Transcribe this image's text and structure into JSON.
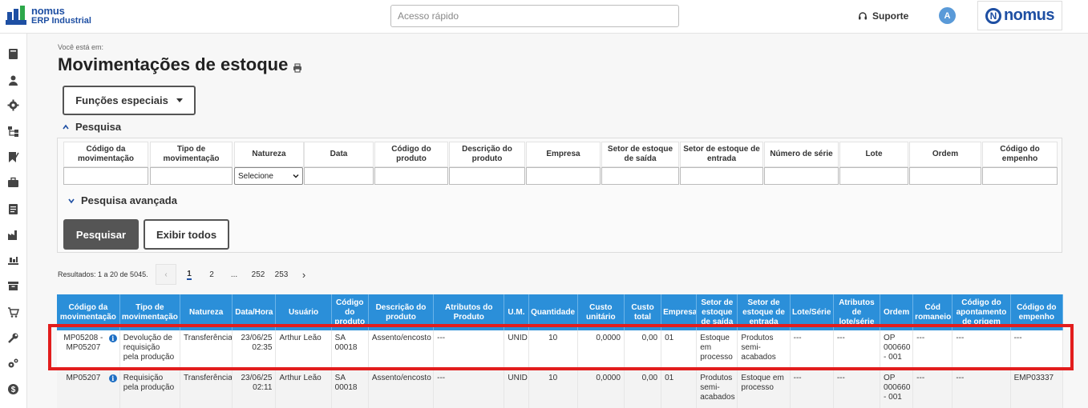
{
  "app": {
    "logo_line1": "nomus",
    "logo_line2": "ERP Industrial",
    "search_placeholder": "Acesso rápido",
    "support_label": "Suporte",
    "avatar_initial": "A",
    "brand_name": "nomus"
  },
  "sidebar": {
    "items": [
      "book-icon",
      "user-icon",
      "gear-icon",
      "hierarchy-icon",
      "bookmark-icon",
      "briefcase-icon",
      "ledger-icon",
      "factory-icon",
      "inventory-icon",
      "archive-icon",
      "cart-icon",
      "tools-icon",
      "cogs-icon",
      "dollar-icon"
    ]
  },
  "page": {
    "breadcrumb": "Você está em:",
    "title": "Movimentações de estoque",
    "functions_button": "Funções especiais",
    "search_section": "Pesquisa",
    "advanced_search": "Pesquisa avançada",
    "search_button": "Pesquisar",
    "show_all_button": "Exibir todos"
  },
  "filters": {
    "headers": [
      "Código da movimentação",
      "Tipo de movimentação",
      "Natureza",
      "Data",
      "Código do produto",
      "Descrição do produto",
      "Empresa",
      "Setor de estoque de saída",
      "Setor de estoque de entrada",
      "Número de série",
      "Lote",
      "Ordem",
      "Código do empenho"
    ],
    "natureza_selected": "Selecione"
  },
  "pagination": {
    "results_text": "Resultados: 1 a 20 de 5045.",
    "prev": "‹",
    "pages": [
      "1",
      "2",
      "...",
      "252",
      "253"
    ],
    "next": "›"
  },
  "table": {
    "columns": [
      "Código da movimentação",
      "Tipo de movimentação",
      "Natureza",
      "Data/Hora",
      "Usuário",
      "Código do produto",
      "Descrição do produto",
      "Atributos do Produto",
      "U.M.",
      "Quantidade",
      "Custo unitário",
      "Custo total",
      "Empresa",
      "Setor de estoque de saída",
      "Setor de estoque de entrada",
      "Lote/Série",
      "Atributos de lote/série",
      "Ordem",
      "Cód romaneio",
      "Código do apontamento de origem",
      "Código do empenho"
    ],
    "rows": [
      {
        "codigo": "MP05208 - MP05207",
        "tipo": "Devolução de requisição pela produção",
        "natureza": "Transferência",
        "data": "23/06/25 02:35",
        "usuario": "Arthur Leão",
        "cod_produto": "SA 00018",
        "descricao": "Assento/encosto",
        "atributos": "---",
        "um": "UNID",
        "quantidade": "10",
        "custo_unitario": "0,0000",
        "custo_total": "0,00",
        "empresa": "01",
        "setor_saida": "Estoque em processo",
        "setor_entrada": "Produtos semi-acabados",
        "lote": "---",
        "atrib_lote": "---",
        "ordem": "OP 000660 - 001",
        "romaneio": "---",
        "apontamento": "---",
        "empenho": "---"
      },
      {
        "codigo": "MP05207",
        "tipo": "Requisição pela produção",
        "natureza": "Transferência",
        "data": "23/06/25 02:11",
        "usuario": "Arthur Leão",
        "cod_produto": "SA 00018",
        "descricao": "Assento/encosto",
        "atributos": "---",
        "um": "UNID",
        "quantidade": "10",
        "custo_unitario": "0,0000",
        "custo_total": "0,00",
        "empresa": "01",
        "setor_saida": "Produtos semi-acabados",
        "setor_entrada": "Estoque em processo",
        "lote": "---",
        "atrib_lote": "---",
        "ordem": "OP 000660 - 001",
        "romaneio": "---",
        "apontamento": "---",
        "empenho": "EMP03337"
      }
    ]
  },
  "colors": {
    "header_blue": "#2b8fd9",
    "brand_blue": "#1e4fa3",
    "highlight_red": "#e21d1d"
  }
}
